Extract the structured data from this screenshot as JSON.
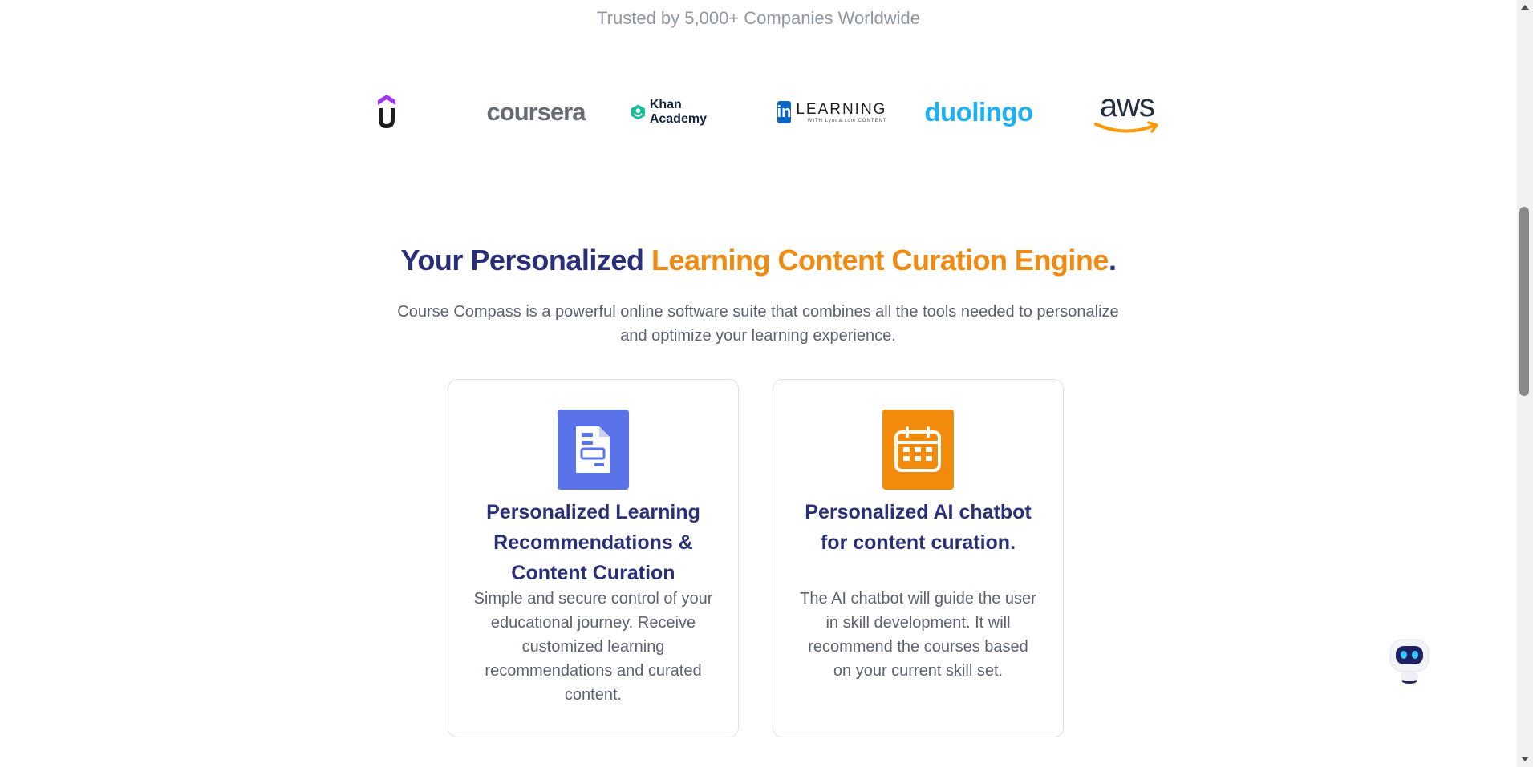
{
  "trusted_heading": "Trusted by 5,000+ Companies Worldwide",
  "logos": {
    "udemy": {
      "icon": "udemy-logo-icon"
    },
    "coursera": {
      "text": "coursera"
    },
    "khan_academy": {
      "text": "Khan Academy"
    },
    "linkedin_learning": {
      "badge": "in",
      "text": "LEARNING",
      "sub": "WITH Lynda.com CONTENT"
    },
    "duolingo": {
      "text": "duolingo"
    },
    "aws": {
      "text": "aws"
    }
  },
  "hero": {
    "headline_part1": "Your Personalized ",
    "headline_highlight": "Learning Content Curation Engine",
    "headline_end": ".",
    "description": "Course Compass is a powerful online software suite that combines all the tools needed to personalize and optimize your learning experience."
  },
  "features": [
    {
      "icon": "document-icon",
      "title": "Personalized Learning Recommendations & Content Curation",
      "description": "Simple and secure control of your educational journey. Receive customized learning recommendations and curated content."
    },
    {
      "icon": "calendar-icon",
      "title": "Personalized AI chatbot for content curation.",
      "description": "The AI chatbot will guide the user in skill development. It will recommend the courses based on your current skill set."
    }
  ],
  "colors": {
    "primary_dark": "#2a2f7a",
    "accent_orange": "#f18a10",
    "doc_icon_bg": "#5b73e8",
    "calendar_icon_bg": "#f28a0c",
    "muted_text": "#8f96a3"
  },
  "chatbot": {
    "icon": "robot-chatbot-icon"
  }
}
